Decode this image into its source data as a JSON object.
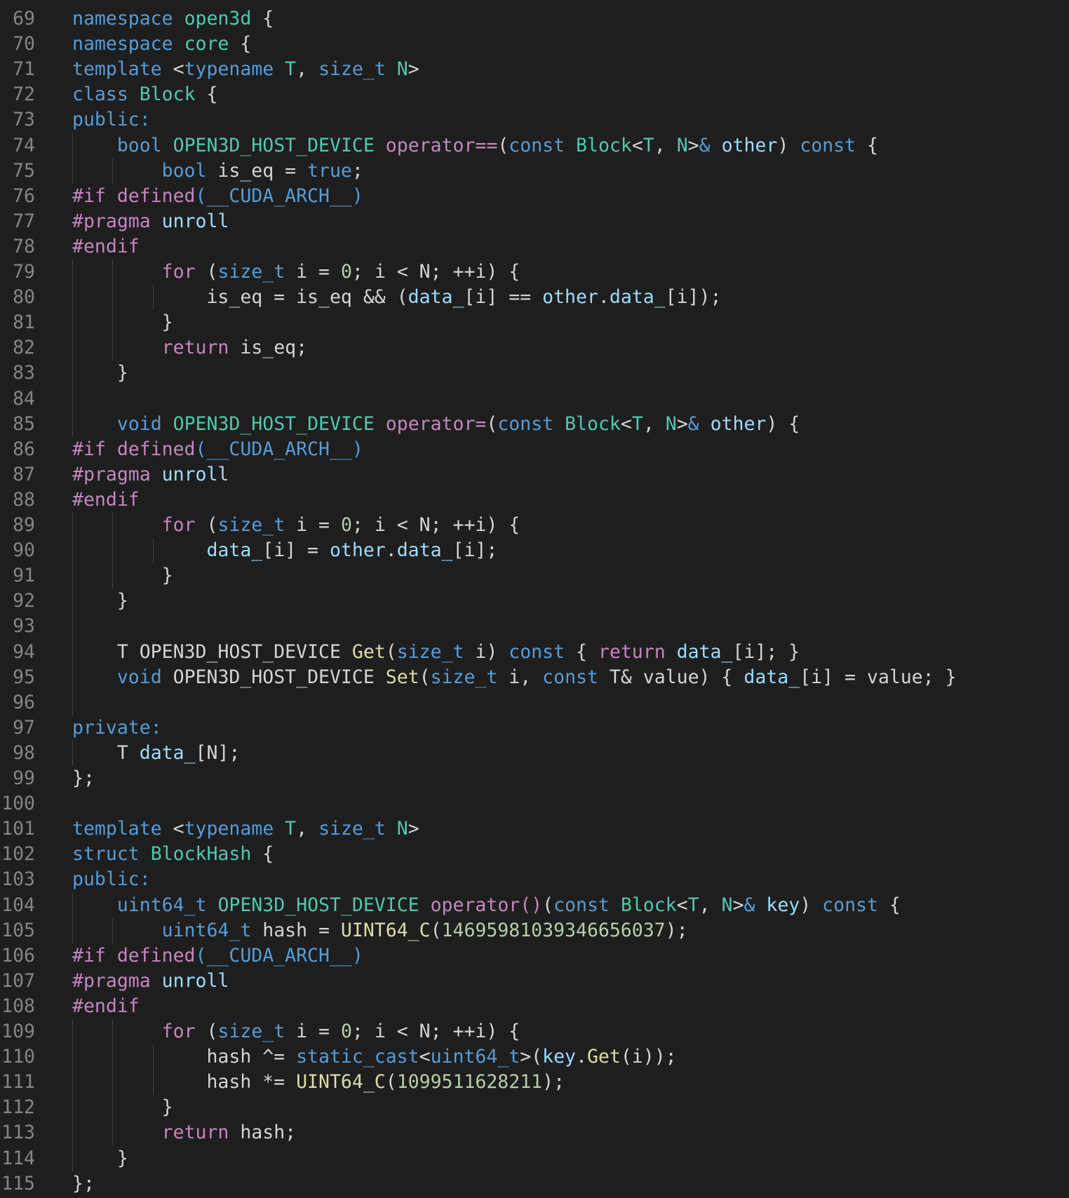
{
  "editor": {
    "lines": [
      {
        "n": "69",
        "indent": 0,
        "tokens": [
          [
            "kw",
            "namespace"
          ],
          [
            "pl",
            " "
          ],
          [
            "ty",
            "open3d"
          ],
          [
            "pl",
            " {"
          ]
        ]
      },
      {
        "n": "70",
        "indent": 0,
        "tokens": [
          [
            "kw",
            "namespace"
          ],
          [
            "pl",
            " "
          ],
          [
            "ty",
            "core"
          ],
          [
            "pl",
            " {"
          ]
        ]
      },
      {
        "n": "71",
        "indent": 0,
        "tokens": [
          [
            "kw",
            "template"
          ],
          [
            "pl",
            " <"
          ],
          [
            "kw",
            "typename"
          ],
          [
            "pl",
            " "
          ],
          [
            "ty",
            "T"
          ],
          [
            "pl",
            ", "
          ],
          [
            "kw",
            "size_t"
          ],
          [
            "pl",
            " "
          ],
          [
            "ty",
            "N"
          ],
          [
            "pl",
            ">"
          ]
        ]
      },
      {
        "n": "72",
        "indent": 0,
        "tokens": [
          [
            "kw",
            "class"
          ],
          [
            "pl",
            " "
          ],
          [
            "ty",
            "Block"
          ],
          [
            "pl",
            " {"
          ]
        ]
      },
      {
        "n": "73",
        "indent": 0,
        "tokens": [
          [
            "kw",
            "public:"
          ]
        ]
      },
      {
        "n": "74",
        "indent": 1,
        "tokens": [
          [
            "pl",
            "    "
          ],
          [
            "kw",
            "bool"
          ],
          [
            "pl",
            " "
          ],
          [
            "ty",
            "OPEN3D_HOST_DEVICE"
          ],
          [
            "pl",
            " "
          ],
          [
            "ctl",
            "operator=="
          ],
          [
            "pl",
            "("
          ],
          [
            "kw",
            "const"
          ],
          [
            "pl",
            " "
          ],
          [
            "ty",
            "Block"
          ],
          [
            "pl",
            "<"
          ],
          [
            "ty",
            "T"
          ],
          [
            "pl",
            ", "
          ],
          [
            "ty",
            "N"
          ],
          [
            "pl",
            ">"
          ],
          [
            "kw",
            "&"
          ],
          [
            "pl",
            " "
          ],
          [
            "var",
            "other"
          ],
          [
            "pl",
            ") "
          ],
          [
            "kw",
            "const"
          ],
          [
            "pl",
            " {"
          ]
        ]
      },
      {
        "n": "75",
        "indent": 2,
        "tokens": [
          [
            "pl",
            "        "
          ],
          [
            "kw",
            "bool"
          ],
          [
            "pl",
            " is_eq = "
          ],
          [
            "kw",
            "true"
          ],
          [
            "pl",
            ";"
          ]
        ]
      },
      {
        "n": "76",
        "indent": 0,
        "tokens": [
          [
            "ctl",
            "#if defined"
          ],
          [
            "kw",
            "("
          ],
          [
            "kw",
            "__CUDA_ARCH__"
          ],
          [
            "kw",
            ")"
          ]
        ]
      },
      {
        "n": "77",
        "indent": 0,
        "tokens": [
          [
            "ctl",
            "#pragma"
          ],
          [
            "pl",
            " "
          ],
          [
            "var",
            "unroll"
          ]
        ]
      },
      {
        "n": "78",
        "indent": 0,
        "tokens": [
          [
            "ctl",
            "#endif"
          ]
        ]
      },
      {
        "n": "79",
        "indent": 2,
        "tokens": [
          [
            "pl",
            "        "
          ],
          [
            "ctl",
            "for"
          ],
          [
            "pl",
            " ("
          ],
          [
            "kw",
            "size_t"
          ],
          [
            "pl",
            " i = "
          ],
          [
            "num",
            "0"
          ],
          [
            "pl",
            "; i < N; ++i) {"
          ]
        ]
      },
      {
        "n": "80",
        "indent": 3,
        "tokens": [
          [
            "pl",
            "            is_eq = is_eq && ("
          ],
          [
            "var",
            "data_"
          ],
          [
            "pl",
            "[i] == "
          ],
          [
            "var",
            "other"
          ],
          [
            "pl",
            "."
          ],
          [
            "var",
            "data_"
          ],
          [
            "pl",
            "[i]);"
          ]
        ]
      },
      {
        "n": "81",
        "indent": 2,
        "tokens": [
          [
            "pl",
            "        }"
          ]
        ]
      },
      {
        "n": "82",
        "indent": 2,
        "tokens": [
          [
            "pl",
            "        "
          ],
          [
            "ctl",
            "return"
          ],
          [
            "pl",
            " is_eq;"
          ]
        ]
      },
      {
        "n": "83",
        "indent": 1,
        "tokens": [
          [
            "pl",
            "    }"
          ]
        ]
      },
      {
        "n": "84",
        "indent": 1,
        "tokens": []
      },
      {
        "n": "85",
        "indent": 1,
        "tokens": [
          [
            "pl",
            "    "
          ],
          [
            "kw",
            "void"
          ],
          [
            "pl",
            " "
          ],
          [
            "ty",
            "OPEN3D_HOST_DEVICE"
          ],
          [
            "pl",
            " "
          ],
          [
            "ctl",
            "operator="
          ],
          [
            "pl",
            "("
          ],
          [
            "kw",
            "const"
          ],
          [
            "pl",
            " "
          ],
          [
            "ty",
            "Block"
          ],
          [
            "pl",
            "<"
          ],
          [
            "ty",
            "T"
          ],
          [
            "pl",
            ", "
          ],
          [
            "ty",
            "N"
          ],
          [
            "pl",
            ">"
          ],
          [
            "kw",
            "&"
          ],
          [
            "pl",
            " "
          ],
          [
            "var",
            "other"
          ],
          [
            "pl",
            ") {"
          ]
        ]
      },
      {
        "n": "86",
        "indent": 0,
        "tokens": [
          [
            "ctl",
            "#if defined"
          ],
          [
            "kw",
            "("
          ],
          [
            "kw",
            "__CUDA_ARCH__"
          ],
          [
            "kw",
            ")"
          ]
        ]
      },
      {
        "n": "87",
        "indent": 0,
        "tokens": [
          [
            "ctl",
            "#pragma"
          ],
          [
            "pl",
            " "
          ],
          [
            "var",
            "unroll"
          ]
        ]
      },
      {
        "n": "88",
        "indent": 0,
        "tokens": [
          [
            "ctl",
            "#endif"
          ]
        ]
      },
      {
        "n": "89",
        "indent": 2,
        "tokens": [
          [
            "pl",
            "        "
          ],
          [
            "ctl",
            "for"
          ],
          [
            "pl",
            " ("
          ],
          [
            "kw",
            "size_t"
          ],
          [
            "pl",
            " i = "
          ],
          [
            "num",
            "0"
          ],
          [
            "pl",
            "; i < N; ++i) {"
          ]
        ]
      },
      {
        "n": "90",
        "indent": 3,
        "tokens": [
          [
            "pl",
            "            "
          ],
          [
            "var",
            "data_"
          ],
          [
            "pl",
            "[i] = "
          ],
          [
            "var",
            "other"
          ],
          [
            "pl",
            "."
          ],
          [
            "var",
            "data_"
          ],
          [
            "pl",
            "[i];"
          ]
        ]
      },
      {
        "n": "91",
        "indent": 2,
        "tokens": [
          [
            "pl",
            "        }"
          ]
        ]
      },
      {
        "n": "92",
        "indent": 1,
        "tokens": [
          [
            "pl",
            "    }"
          ]
        ]
      },
      {
        "n": "93",
        "indent": 1,
        "tokens": []
      },
      {
        "n": "94",
        "indent": 1,
        "tokens": [
          [
            "pl",
            "    T OPEN3D_HOST_DEVICE "
          ],
          [
            "fn",
            "Get"
          ],
          [
            "pl",
            "("
          ],
          [
            "kw",
            "size_t"
          ],
          [
            "pl",
            " i) "
          ],
          [
            "kw",
            "const"
          ],
          [
            "pl",
            " { "
          ],
          [
            "ctl",
            "return"
          ],
          [
            "pl",
            " "
          ],
          [
            "var",
            "data_"
          ],
          [
            "pl",
            "[i]; }"
          ]
        ]
      },
      {
        "n": "95",
        "indent": 1,
        "tokens": [
          [
            "pl",
            "    "
          ],
          [
            "kw",
            "void"
          ],
          [
            "pl",
            " OPEN3D_HOST_DEVICE "
          ],
          [
            "fn",
            "Set"
          ],
          [
            "pl",
            "("
          ],
          [
            "kw",
            "size_t"
          ],
          [
            "pl",
            " i, "
          ],
          [
            "kw",
            "const"
          ],
          [
            "pl",
            " T& value) { "
          ],
          [
            "var",
            "data_"
          ],
          [
            "pl",
            "[i] = value; }"
          ]
        ]
      },
      {
        "n": "96",
        "indent": 1,
        "tokens": []
      },
      {
        "n": "97",
        "indent": 0,
        "tokens": [
          [
            "kw",
            "private:"
          ]
        ]
      },
      {
        "n": "98",
        "indent": 1,
        "tokens": [
          [
            "pl",
            "    T "
          ],
          [
            "var",
            "data_"
          ],
          [
            "pl",
            "[N];"
          ]
        ]
      },
      {
        "n": "99",
        "indent": 0,
        "tokens": [
          [
            "pl",
            "};"
          ]
        ]
      },
      {
        "n": "100",
        "indent": 0,
        "tokens": []
      },
      {
        "n": "101",
        "indent": 0,
        "tokens": [
          [
            "kw",
            "template"
          ],
          [
            "pl",
            " <"
          ],
          [
            "kw",
            "typename"
          ],
          [
            "pl",
            " "
          ],
          [
            "ty",
            "T"
          ],
          [
            "pl",
            ", "
          ],
          [
            "kw",
            "size_t"
          ],
          [
            "pl",
            " "
          ],
          [
            "ty",
            "N"
          ],
          [
            "pl",
            ">"
          ]
        ]
      },
      {
        "n": "102",
        "indent": 0,
        "tokens": [
          [
            "kw",
            "struct"
          ],
          [
            "pl",
            " "
          ],
          [
            "ty",
            "BlockHash"
          ],
          [
            "pl",
            " {"
          ]
        ]
      },
      {
        "n": "103",
        "indent": 0,
        "tokens": [
          [
            "kw",
            "public:"
          ]
        ]
      },
      {
        "n": "104",
        "indent": 1,
        "tokens": [
          [
            "pl",
            "    "
          ],
          [
            "kw",
            "uint64_t"
          ],
          [
            "pl",
            " "
          ],
          [
            "ty",
            "OPEN3D_HOST_DEVICE"
          ],
          [
            "pl",
            " "
          ],
          [
            "ctl",
            "operator()"
          ],
          [
            "pl",
            "("
          ],
          [
            "kw",
            "const"
          ],
          [
            "pl",
            " "
          ],
          [
            "ty",
            "Block"
          ],
          [
            "pl",
            "<"
          ],
          [
            "ty",
            "T"
          ],
          [
            "pl",
            ", "
          ],
          [
            "ty",
            "N"
          ],
          [
            "pl",
            ">"
          ],
          [
            "kw",
            "&"
          ],
          [
            "pl",
            " "
          ],
          [
            "var",
            "key"
          ],
          [
            "pl",
            ") "
          ],
          [
            "kw",
            "const"
          ],
          [
            "pl",
            " {"
          ]
        ]
      },
      {
        "n": "105",
        "indent": 2,
        "tokens": [
          [
            "pl",
            "        "
          ],
          [
            "kw",
            "uint64_t"
          ],
          [
            "pl",
            " hash = "
          ],
          [
            "fn",
            "UINT64_C"
          ],
          [
            "pl",
            "("
          ],
          [
            "num",
            "14695981039346656037"
          ],
          [
            "pl",
            ");"
          ]
        ]
      },
      {
        "n": "106",
        "indent": 0,
        "tokens": [
          [
            "ctl",
            "#if defined"
          ],
          [
            "kw",
            "("
          ],
          [
            "kw",
            "__CUDA_ARCH__"
          ],
          [
            "kw",
            ")"
          ]
        ]
      },
      {
        "n": "107",
        "indent": 0,
        "tokens": [
          [
            "ctl",
            "#pragma"
          ],
          [
            "pl",
            " "
          ],
          [
            "var",
            "unroll"
          ]
        ]
      },
      {
        "n": "108",
        "indent": 0,
        "tokens": [
          [
            "ctl",
            "#endif"
          ]
        ]
      },
      {
        "n": "109",
        "indent": 2,
        "tokens": [
          [
            "pl",
            "        "
          ],
          [
            "ctl",
            "for"
          ],
          [
            "pl",
            " ("
          ],
          [
            "kw",
            "size_t"
          ],
          [
            "pl",
            " i = "
          ],
          [
            "num",
            "0"
          ],
          [
            "pl",
            "; i < N; ++i) {"
          ]
        ]
      },
      {
        "n": "110",
        "indent": 3,
        "tokens": [
          [
            "pl",
            "            hash ^= "
          ],
          [
            "kw",
            "static_cast"
          ],
          [
            "pl",
            "<"
          ],
          [
            "kw",
            "uint64_t"
          ],
          [
            "pl",
            ">("
          ],
          [
            "var",
            "key"
          ],
          [
            "pl",
            "."
          ],
          [
            "fn",
            "Get"
          ],
          [
            "pl",
            "(i));"
          ]
        ]
      },
      {
        "n": "111",
        "indent": 3,
        "tokens": [
          [
            "pl",
            "            hash *= "
          ],
          [
            "fn",
            "UINT64_C"
          ],
          [
            "pl",
            "("
          ],
          [
            "num",
            "1099511628211"
          ],
          [
            "pl",
            ");"
          ]
        ]
      },
      {
        "n": "112",
        "indent": 2,
        "tokens": [
          [
            "pl",
            "        }"
          ]
        ]
      },
      {
        "n": "113",
        "indent": 2,
        "tokens": [
          [
            "pl",
            "        "
          ],
          [
            "ctl",
            "return"
          ],
          [
            "pl",
            " hash;"
          ]
        ]
      },
      {
        "n": "114",
        "indent": 1,
        "tokens": [
          [
            "pl",
            "    }"
          ]
        ]
      },
      {
        "n": "115",
        "indent": 0,
        "tokens": [
          [
            "pl",
            "};"
          ]
        ]
      }
    ]
  }
}
